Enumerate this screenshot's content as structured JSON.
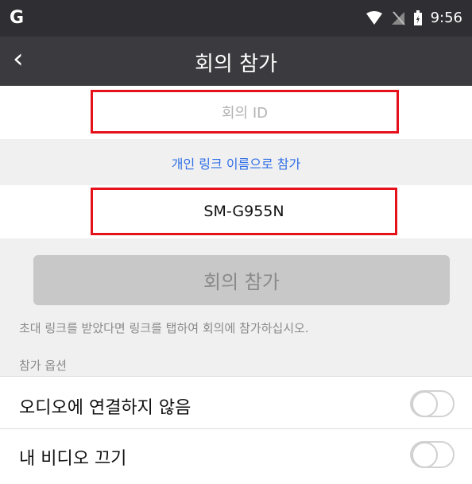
{
  "status_bar": {
    "app_icon_text": "G",
    "time": "9:56",
    "icons": [
      "wifi-icon",
      "signal-icon",
      "battery-icon"
    ]
  },
  "nav": {
    "back_icon": "chevron-left-icon",
    "title": "회의 참가"
  },
  "form": {
    "meeting_id_placeholder": "회의 ID",
    "personal_link_label": "개인 링크 이름으로 참가",
    "name_value": "SM-G955N",
    "join_button_label": "회의 참가",
    "hint_text": "초대 링크를 받았다면 링크를 탭하여 회의에 참가하십시오."
  },
  "options": {
    "section_label": "참가 옵션",
    "items": [
      {
        "label": "오디오에 연결하지 않음",
        "enabled": false
      },
      {
        "label": "내 비디오 끄기",
        "enabled": false
      }
    ]
  },
  "colors": {
    "highlight": "#e5121c",
    "link": "#2f6fe6",
    "nav_bg": "#3a3a3f"
  }
}
